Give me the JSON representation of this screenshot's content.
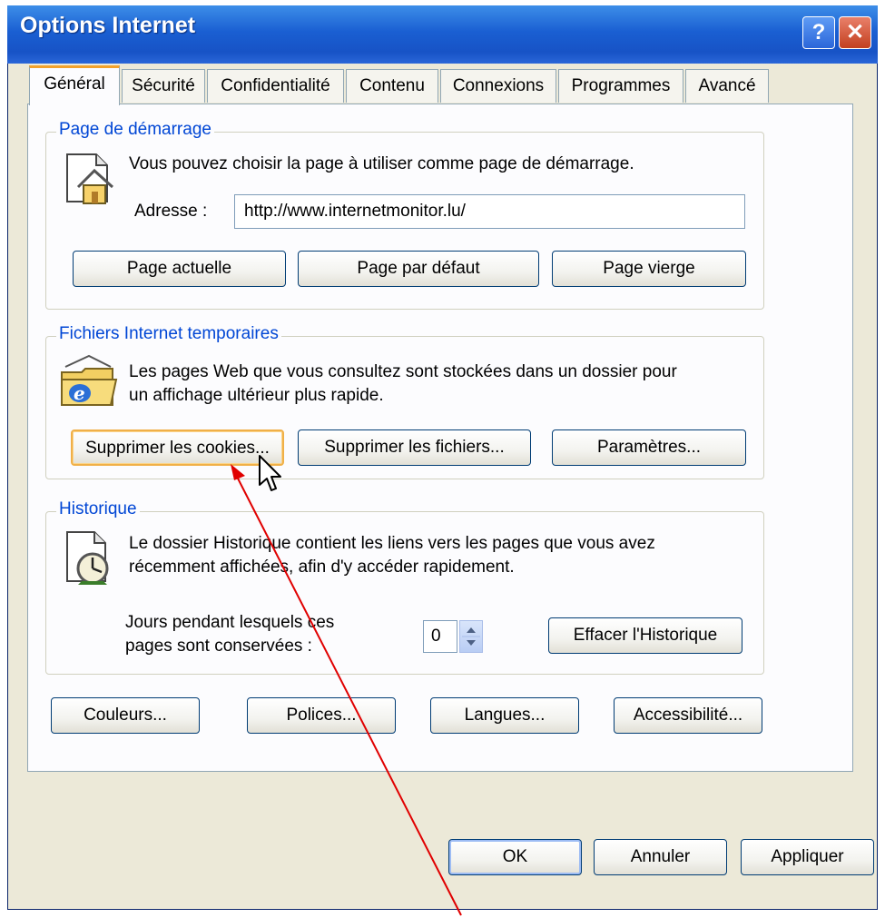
{
  "window": {
    "title": "Options Internet",
    "help_glyph": "?",
    "close_glyph": "✕"
  },
  "tabs": [
    {
      "label": "Général",
      "active": true
    },
    {
      "label": "Sécurité"
    },
    {
      "label": "Confidentialité"
    },
    {
      "label": "Contenu"
    },
    {
      "label": "Connexions"
    },
    {
      "label": "Programmes"
    },
    {
      "label": "Avancé"
    }
  ],
  "homepage": {
    "legend": "Page de démarrage",
    "description": "Vous pouvez choisir la page à utiliser comme page de démarrage.",
    "address_label": "Adresse :",
    "address_value": "http://www.internetmonitor.lu/",
    "buttons": {
      "current": "Page actuelle",
      "default": "Page par défaut",
      "blank": "Page vierge"
    }
  },
  "temp_files": {
    "legend": "Fichiers Internet temporaires",
    "description_line1": "Les pages Web que vous consultez sont stockées dans un dossier pour",
    "description_line2": "un affichage ultérieur plus rapide.",
    "buttons": {
      "cookies": "Supprimer les cookies...",
      "files": "Supprimer les fichiers...",
      "settings": "Paramètres..."
    }
  },
  "history": {
    "legend": "Historique",
    "description_line1": "Le dossier Historique contient les liens vers les pages que vous avez",
    "description_line2": "récemment affichées, afin d'y accéder rapidement.",
    "days_label_line1": "Jours pendant lesquels ces",
    "days_label_line2": "pages sont conservées :",
    "days_value": "0",
    "clear_button": "Effacer l'Historique"
  },
  "bottom_buttons": {
    "colors": "Couleurs...",
    "fonts": "Polices...",
    "languages": "Langues...",
    "accessibility": "Accessibilité..."
  },
  "footer": {
    "ok": "OK",
    "cancel": "Annuler",
    "apply": "Appliquer"
  },
  "icons": {
    "homepage": "house-page-icon",
    "temp_files": "ie-folder-icon",
    "history": "history-clock-icon",
    "cursor": "mouse-cursor-icon",
    "annotation": "red-arrow-annotation"
  },
  "colors": {
    "titlebar": "#1a5fd2",
    "legend_text": "#0046d5",
    "focus_border": "#f0b048",
    "annotation": "#e00000",
    "dialog_bg": "#ece9d8"
  }
}
